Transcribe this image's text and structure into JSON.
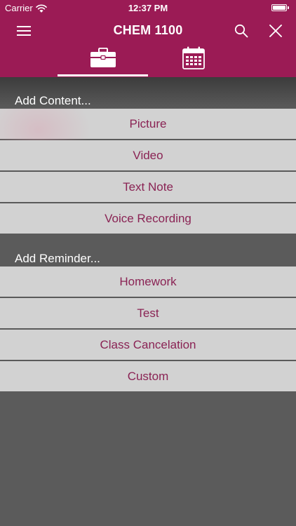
{
  "status_bar": {
    "carrier": "Carrier",
    "time": "12:37 PM"
  },
  "nav": {
    "title": "CHEM 1100",
    "menu_icon": "hamburger-menu-icon",
    "search_icon": "search-icon",
    "close_icon": "close-icon"
  },
  "tabs": [
    {
      "icon": "briefcase-icon",
      "selected": true
    },
    {
      "icon": "calendar-icon",
      "selected": false
    }
  ],
  "sections": {
    "add_content": {
      "header": "Add Content...",
      "items": [
        "Picture",
        "Video",
        "Text Note",
        "Voice Recording"
      ]
    },
    "add_reminder": {
      "header": "Add Reminder...",
      "items": [
        "Homework",
        "Test",
        "Class Cancelation",
        "Custom"
      ]
    }
  },
  "colors": {
    "brand": "#9b1b55",
    "item_text": "#8a2354",
    "item_background": "#d2d2d2",
    "panel_background": "#5b5b5b"
  }
}
